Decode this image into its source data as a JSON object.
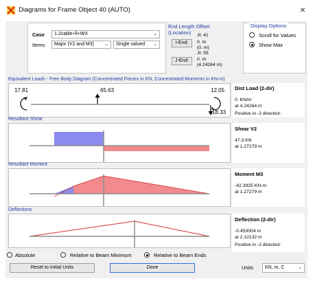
{
  "window": {
    "title": "Diagrams for Frame Object 40  (AUTO)",
    "close_glyph": "×"
  },
  "case": {
    "case_label": "Case",
    "case_value": "1.2cable+ll+WX",
    "items_label": "Items",
    "items_value": "Major (V2 and M3)",
    "valued_value": "Single valued"
  },
  "end_offset": {
    "title_line1": "End Length Offset",
    "title_line2": "(Location)",
    "i_end_button": "I-End:",
    "j_end_button": "J-End:",
    "i_jt": "Jt:  41",
    "i_val1": "0. m",
    "i_val2": "(0. m)",
    "j_jt": "Jt:  55",
    "j_val1": "0. m",
    "j_val2": "(4.24264 m)"
  },
  "display_options": {
    "title": "Display Options",
    "scroll_label": "Scroll for Values",
    "show_max_label": "Show Max",
    "selected": "show_max"
  },
  "equivalent_loads": {
    "title": "Equivalent Loads - Free Body Diagram  (Concentrated Forces in KN, Concentrated Moments in KN-m)",
    "left_moment": "17.81",
    "left_force": "65.63",
    "right_moment": "12.05",
    "right_force": "18.33",
    "info_head": "Dist Load (2-dir)",
    "info_value": "0. KN/m",
    "info_at": "at 4.24264 m",
    "info_dir": "Positive in -2 direction"
  },
  "shear": {
    "title": "Resultant Shear",
    "info_head": "Shear V2",
    "info_value": "47.3 KN",
    "info_at": "at 1.27279 m"
  },
  "moment": {
    "title": "Resultant Moment",
    "info_head": "Moment M3",
    "info_value": "-42.3925 KN-m",
    "info_at": "at 1.27279 m"
  },
  "deflection": {
    "title": "Deflections",
    "info_head": "Deflection (2-dir)",
    "info_value": "-0.453004 m",
    "info_at": "at 2.12132 m",
    "info_dir": "Positive in -2 direction"
  },
  "bottom": {
    "absolute_label": "Absolute",
    "rel_min_label": "Relative to Beam Minimum",
    "rel_ends_label": "Relative to Beam Ends",
    "selected": "rel_ends",
    "reset_button": "Reset to Initial Units",
    "done_button": "Done",
    "units_label": "Units",
    "units_value": "KN, m, C"
  },
  "colors": {
    "positive_fill": "#f28a8e",
    "negative_fill": "#8b8bef",
    "diagram_line": "#d23030",
    "accent_title": "#1f3ea5"
  }
}
